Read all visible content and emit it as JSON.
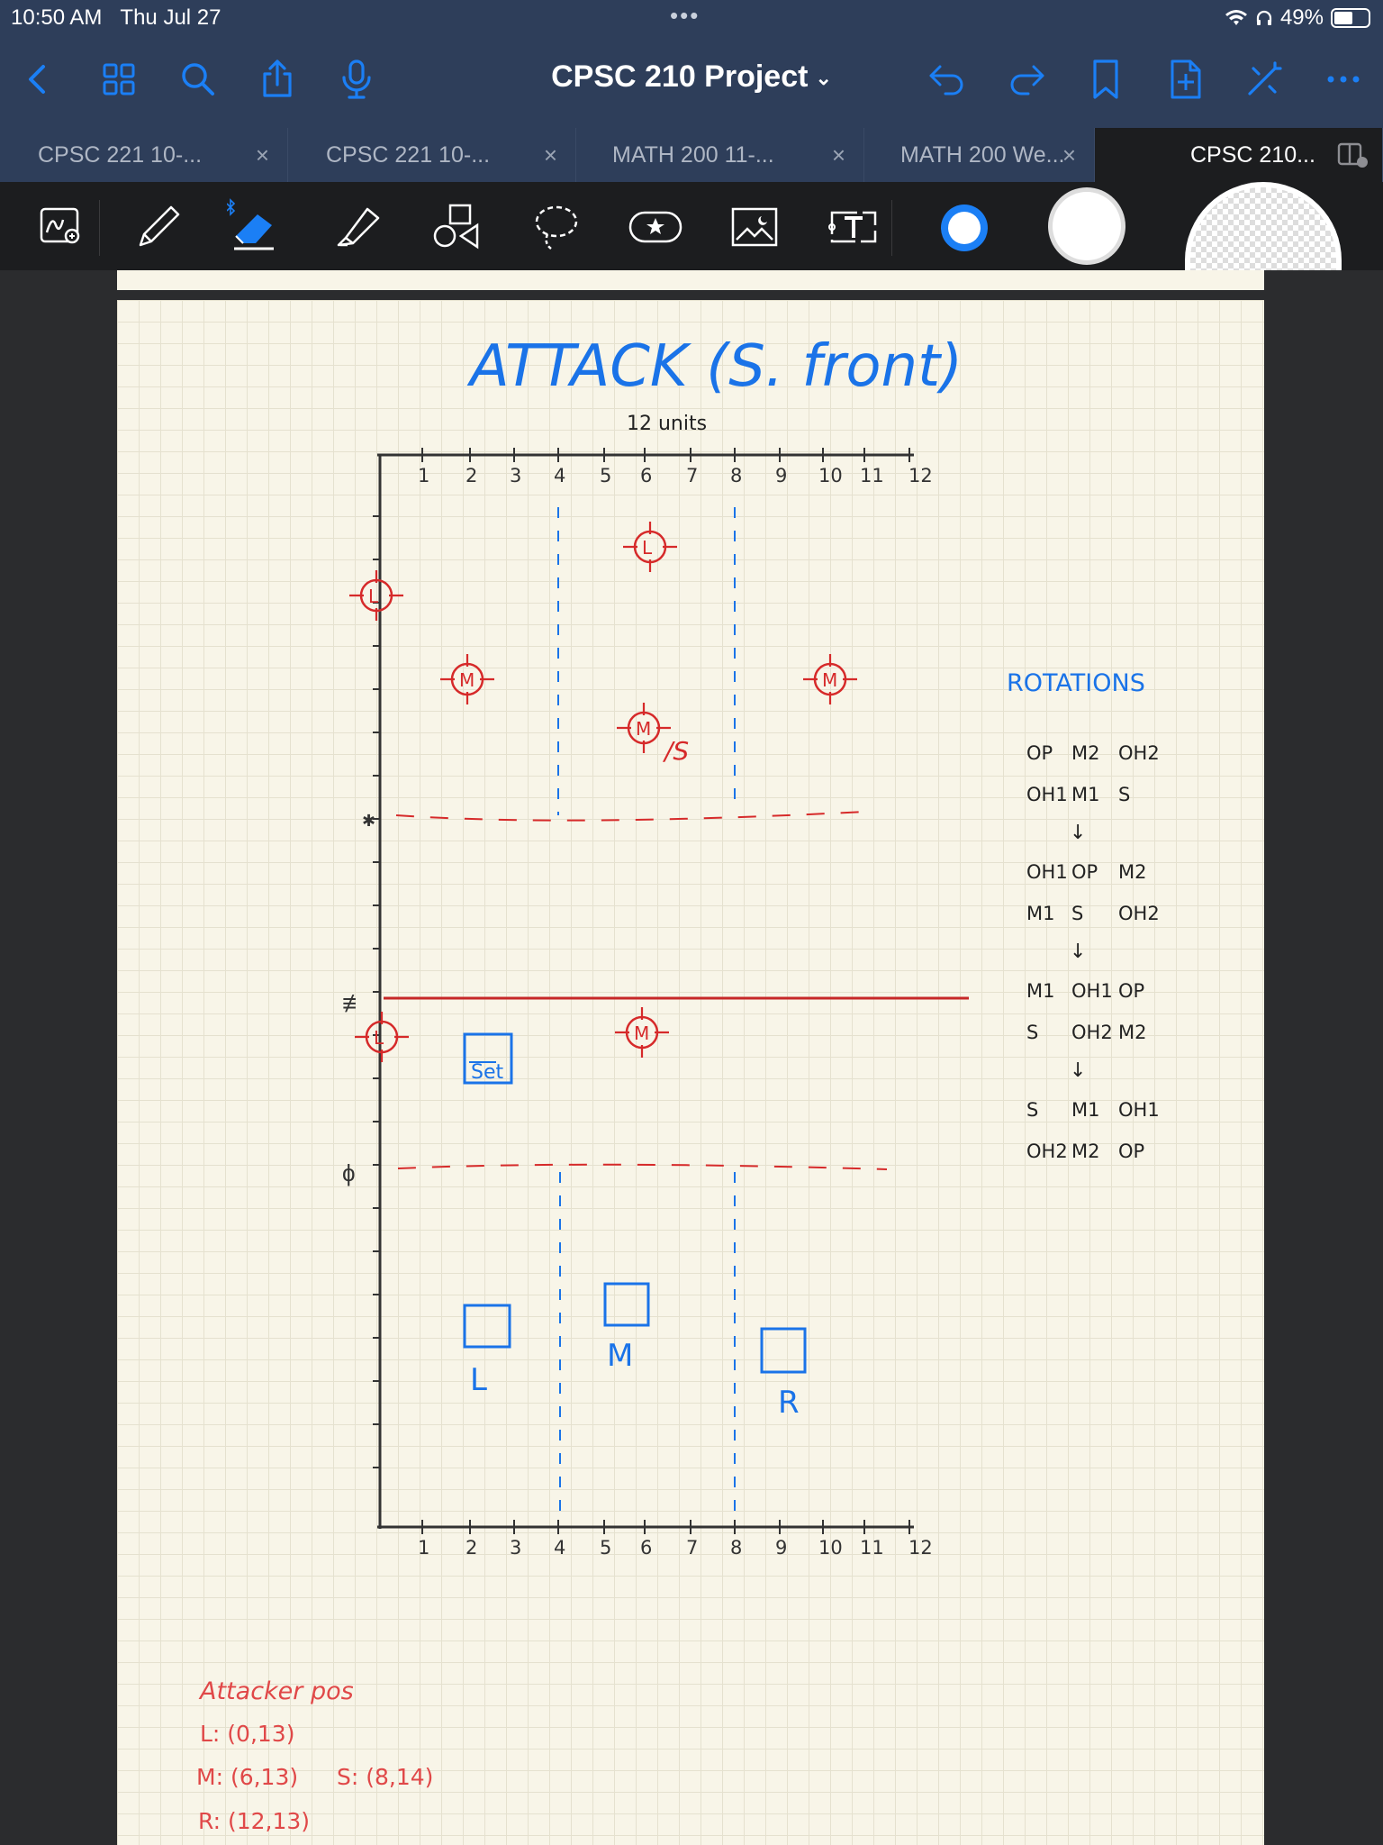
{
  "status_bar": {
    "time": "10:50 AM",
    "date": "Thu Jul 27",
    "battery": "49%"
  },
  "nav": {
    "title": "CPSC 210 Project"
  },
  "tabs": [
    {
      "label": "CPSC 221 10-..."
    },
    {
      "label": "CPSC 221 10-..."
    },
    {
      "label": "MATH 200 11-..."
    },
    {
      "label": "MATH 200 We..."
    },
    {
      "label": "CPSC 210..."
    }
  ],
  "toolbar_tools": [
    "lasso-zoom-icon",
    "pen-icon",
    "eraser-icon",
    "highlighter-icon",
    "shapes-icon",
    "lasso-icon",
    "sticker-icon",
    "image-icon",
    "text-icon"
  ],
  "colors": {
    "chrome": "#2e3e5a",
    "accent": "#1b7ff5",
    "ink_blue": "#1a73e8",
    "ink_red": "#d62a2a",
    "paper": "#f8f5e8"
  },
  "note": {
    "title": "ATTACK (S. front)",
    "width_label": "12 units",
    "x_ticks": [
      "1",
      "2",
      "3",
      "4",
      "5",
      "6",
      "7",
      "8",
      "9",
      "10",
      "11",
      "12"
    ],
    "players_red": [
      {
        "label": "L"
      },
      {
        "label": "L"
      },
      {
        "label": "M"
      },
      {
        "label": "M"
      },
      {
        "label": "M",
        "suffix": "/S"
      },
      {
        "label": "L"
      },
      {
        "label": "M"
      }
    ],
    "markers_blue": [
      {
        "label": "L"
      },
      {
        "label": "M"
      },
      {
        "label": "R"
      },
      {
        "label": "Set"
      }
    ],
    "rotations": {
      "heading": "ROTATIONS",
      "groups": [
        [
          [
            "OP",
            "M2",
            "OH2"
          ],
          [
            "OH1",
            "M1",
            "S"
          ]
        ],
        [
          [
            "OH1",
            "OP",
            "M2"
          ],
          [
            "M1",
            "S",
            "OH2"
          ]
        ],
        [
          [
            "M1",
            "OH1",
            "OP"
          ],
          [
            "S",
            "OH2",
            "M2"
          ]
        ],
        [
          [
            "S",
            "M1",
            "OH1"
          ],
          [
            "OH2",
            "M2",
            "OP"
          ]
        ]
      ],
      "arrow": "↓"
    },
    "attacker_pos": {
      "heading": "Attacker pos",
      "l": "L: (0,13)",
      "m": "M: (6,13)",
      "s": "S: (8,14)",
      "r": "R: (12,13)"
    }
  }
}
